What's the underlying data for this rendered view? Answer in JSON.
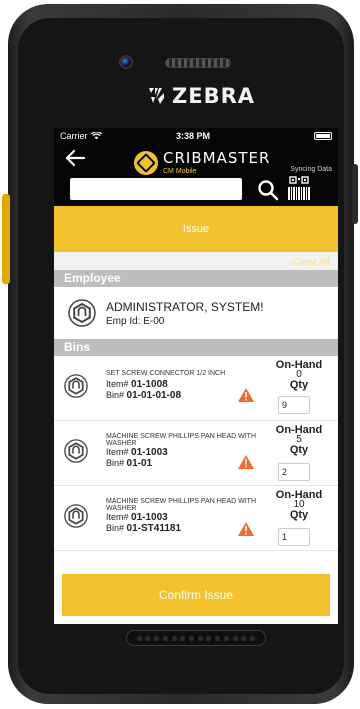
{
  "device": {
    "brand": "ZEBRA"
  },
  "status_bar": {
    "carrier": "Carrier",
    "time": "3:38 PM"
  },
  "app_bar": {
    "app_name": "CRIBMASTER",
    "app_sub": "CM Mobile",
    "sync_status": "Syncing Data",
    "search_placeholder": "",
    "search_value": ""
  },
  "tab": {
    "label": "Issue"
  },
  "actions": {
    "clear_all": "Clear All",
    "confirm": "Confirm Issue"
  },
  "employee_section": {
    "title": "Employee",
    "name": "ADMINISTRATOR, SYSTEM!",
    "emp_id_label": "Emp Id:",
    "emp_id": "E-00"
  },
  "bins_section": {
    "title": "Bins",
    "items": [
      {
        "description": "SET SCREW CONNECTOR 1/2 INCH",
        "item_label": "Item#",
        "item_no": "01-1008",
        "bin_label": "Bin#",
        "bin_no": "01-01-01-08",
        "onhand_label": "On-Hand",
        "onhand": "0",
        "qty_label": "Qty",
        "qty": "9"
      },
      {
        "description": "MACHINE SCREW PHILLIPS PAN HEAD WITH WASHER",
        "item_label": "Item#",
        "item_no": "01-1003",
        "bin_label": "Bin#",
        "bin_no": "01-01",
        "onhand_label": "On-Hand",
        "onhand": "5",
        "qty_label": "Qty",
        "qty": "2"
      },
      {
        "description": "MACHINE SCREW PHILLIPS PAN HEAD WITH WASHER",
        "item_label": "Item#",
        "item_no": "01-1003",
        "bin_label": "Bin#",
        "bin_no": "01-ST41181",
        "onhand_label": "On-Hand",
        "onhand": "10",
        "qty_label": "Qty",
        "qty": "1"
      }
    ]
  },
  "colors": {
    "accent": "#f2c12e",
    "section_header": "#bdbdbd",
    "warning": "#f26b2a",
    "appbar": "#050505"
  },
  "icons": [
    "camera",
    "zebra-logo-icon",
    "wifi-icon",
    "battery-icon",
    "back-arrow-icon",
    "cribmaster-logo-icon",
    "search-icon",
    "barcode-scan-icon",
    "hex-nut-icon",
    "warning-icon"
  ]
}
